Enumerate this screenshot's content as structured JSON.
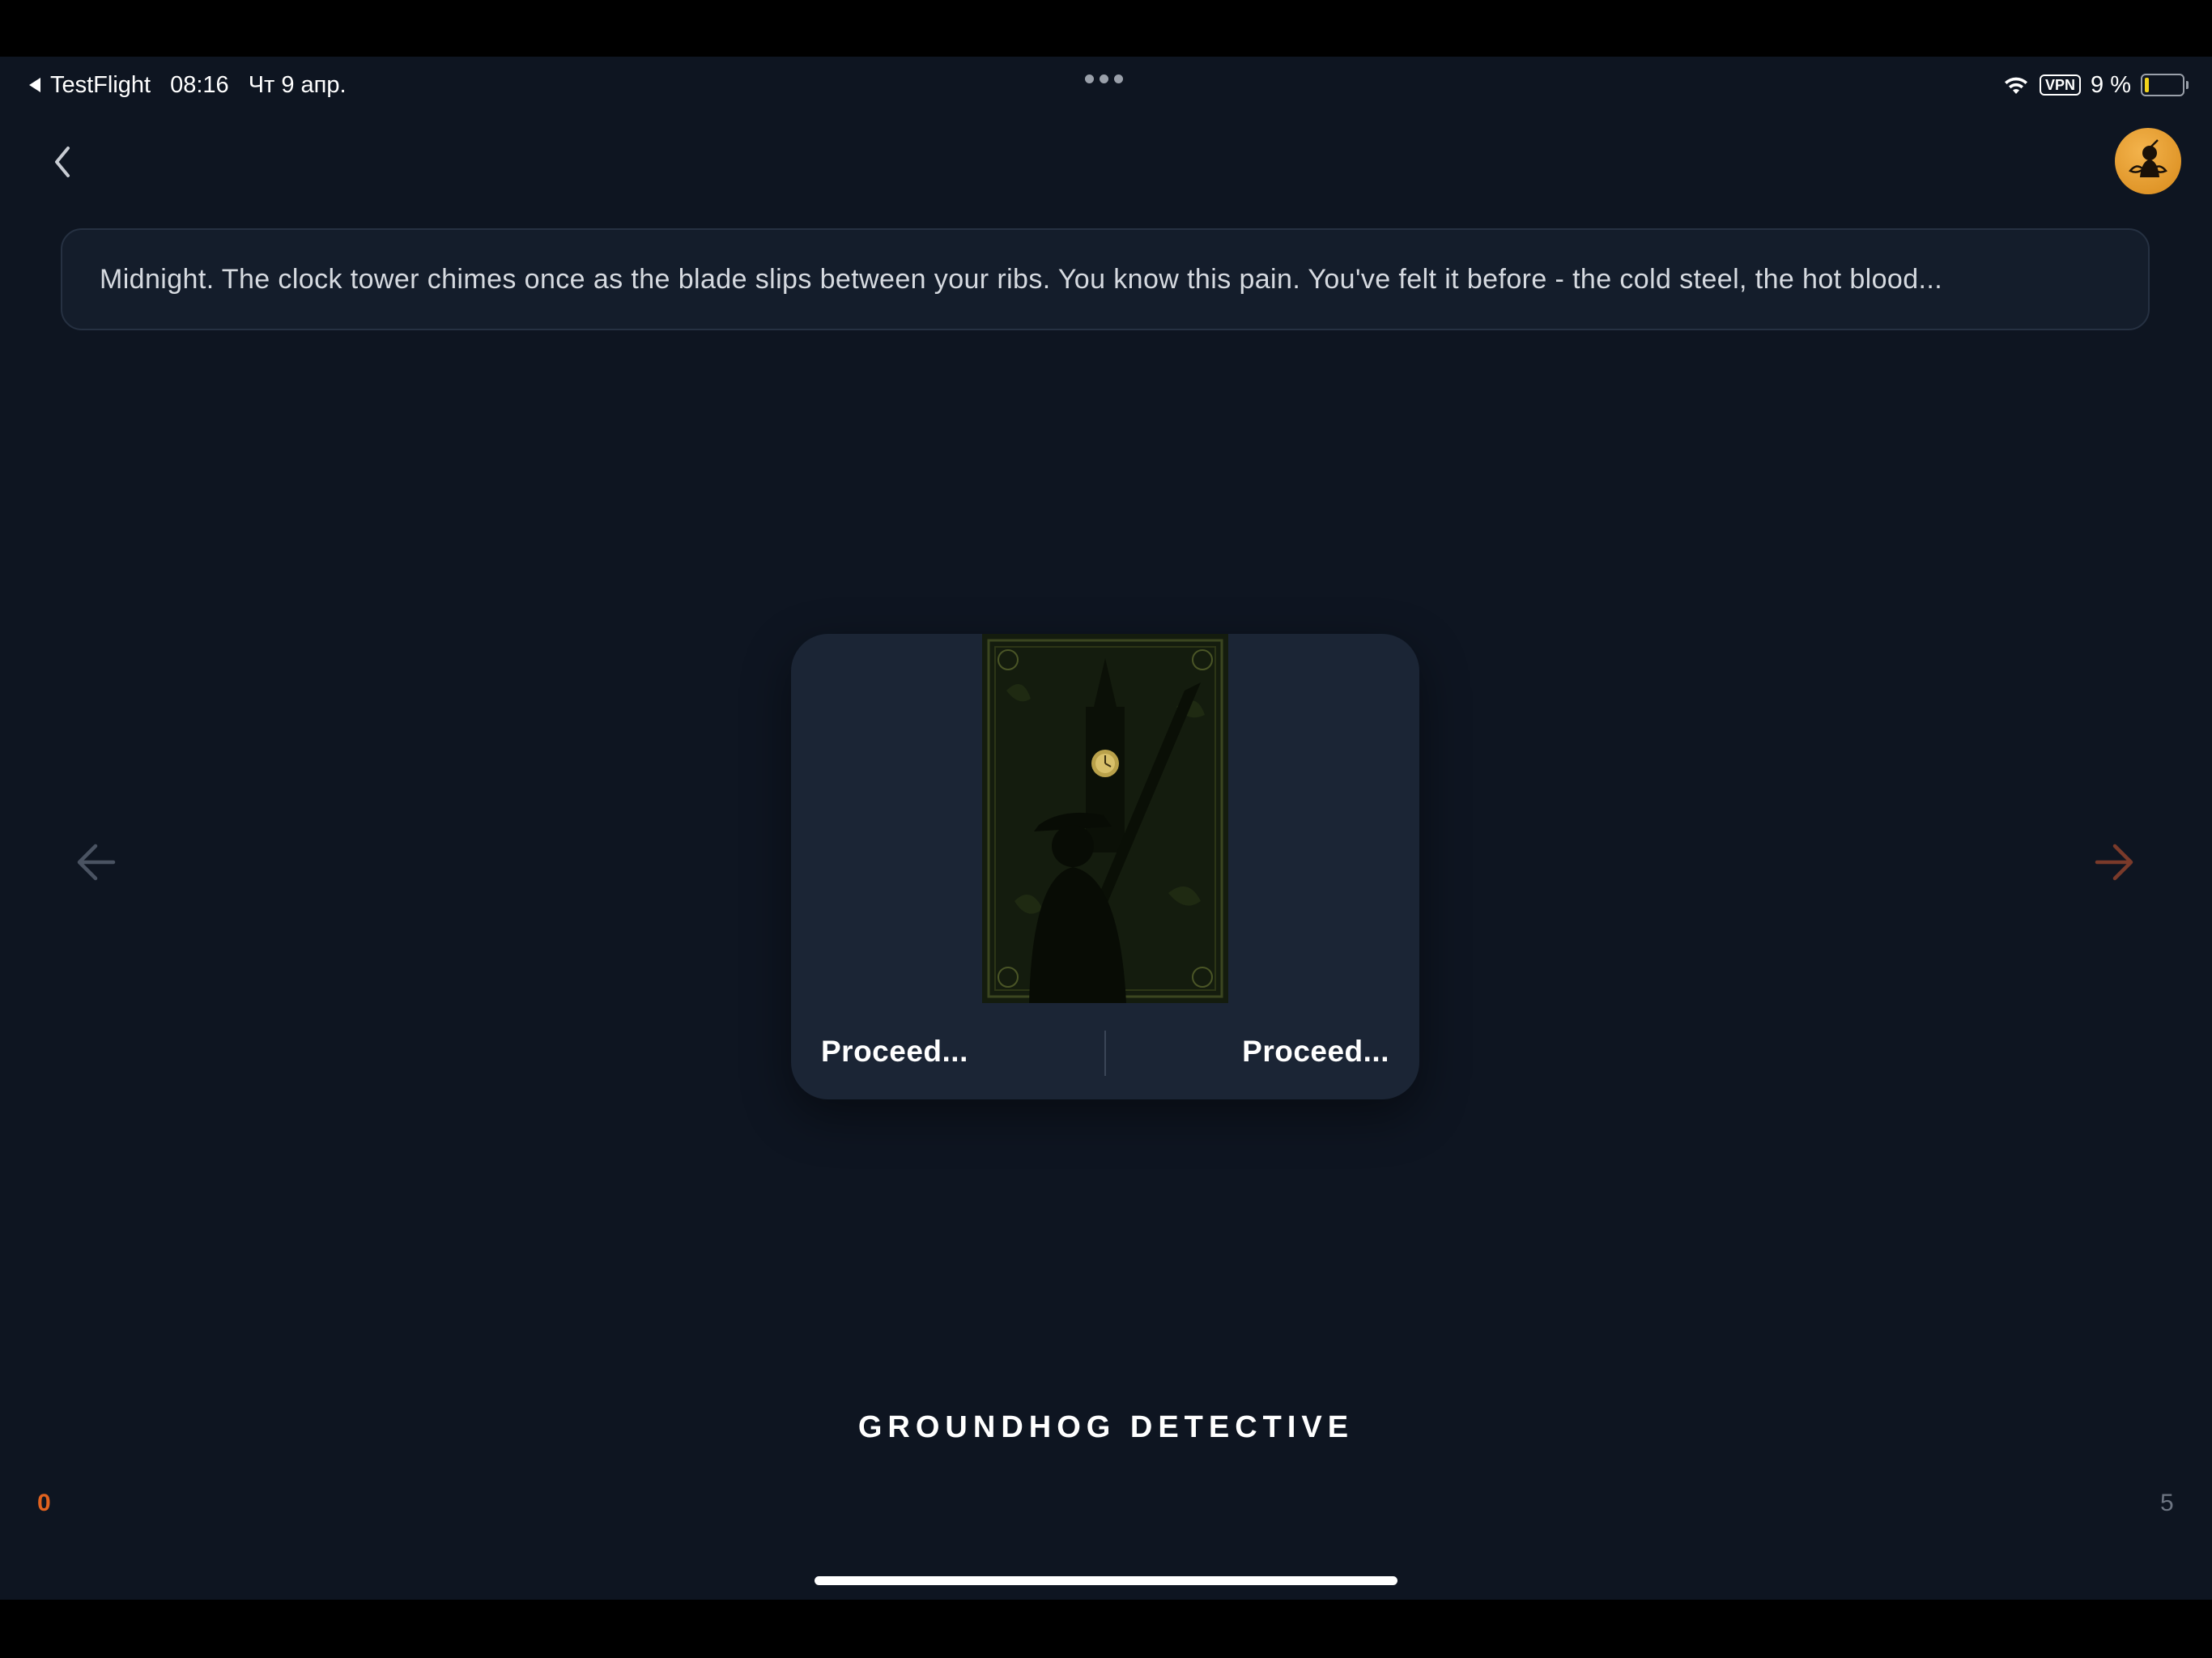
{
  "status_bar": {
    "back_app": "TestFlight",
    "time": "08:16",
    "date": "Чт 9 апр.",
    "vpn": "VPN",
    "battery_text": "9 %",
    "battery_level": 0.09,
    "battery_color": "#f2d31b"
  },
  "nav": {
    "back_icon": "chevron-left-icon",
    "avatar_icon": "avatar-icon"
  },
  "story": {
    "text": "Midnight. The clock tower chimes once as the blade slips between your ribs. You know this pain. You've felt it before - the cold steel, the hot blood..."
  },
  "card": {
    "art_icon": "clock-tower-detective-illustration",
    "left_choice": "Proceed...",
    "right_choice": "Proceed..."
  },
  "arrows": {
    "left_icon": "arrow-left-icon",
    "right_icon": "arrow-right-icon",
    "left_color": "#4a5362",
    "right_color": "#7a3a2a"
  },
  "game": {
    "title": "GROUNDHOG DETECTIVE"
  },
  "counters": {
    "left": "0",
    "right": "5",
    "left_color": "#e0621f"
  }
}
